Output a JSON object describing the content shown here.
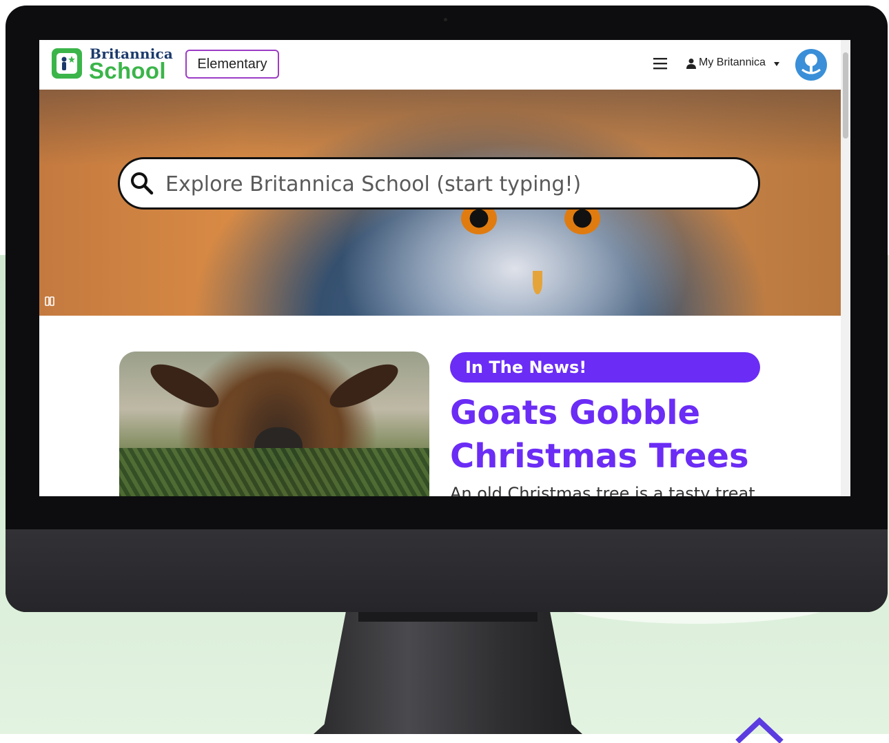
{
  "header": {
    "logo": {
      "line1": "Britannica",
      "line2": "School"
    },
    "level_label": "Elementary",
    "menu_icon": "hamburger-menu-icon",
    "account_label": "My Britannica",
    "account_icon": "user-icon",
    "globe_icon": "globe-icon"
  },
  "hero": {
    "search": {
      "placeholder": "Explore Britannica School (start typing!)",
      "value": ""
    },
    "pause_icon": "pause-icon"
  },
  "news": {
    "badge": "In The News!",
    "title": "Goats Gobble Christmas Trees",
    "teaser": "An old Christmas tree is a tasty treat"
  },
  "colors": {
    "brand_green": "#3bb54a",
    "brand_navy": "#1b3a6b",
    "accent_purple": "#6b2cf5",
    "level_border": "#9c3cc4"
  }
}
